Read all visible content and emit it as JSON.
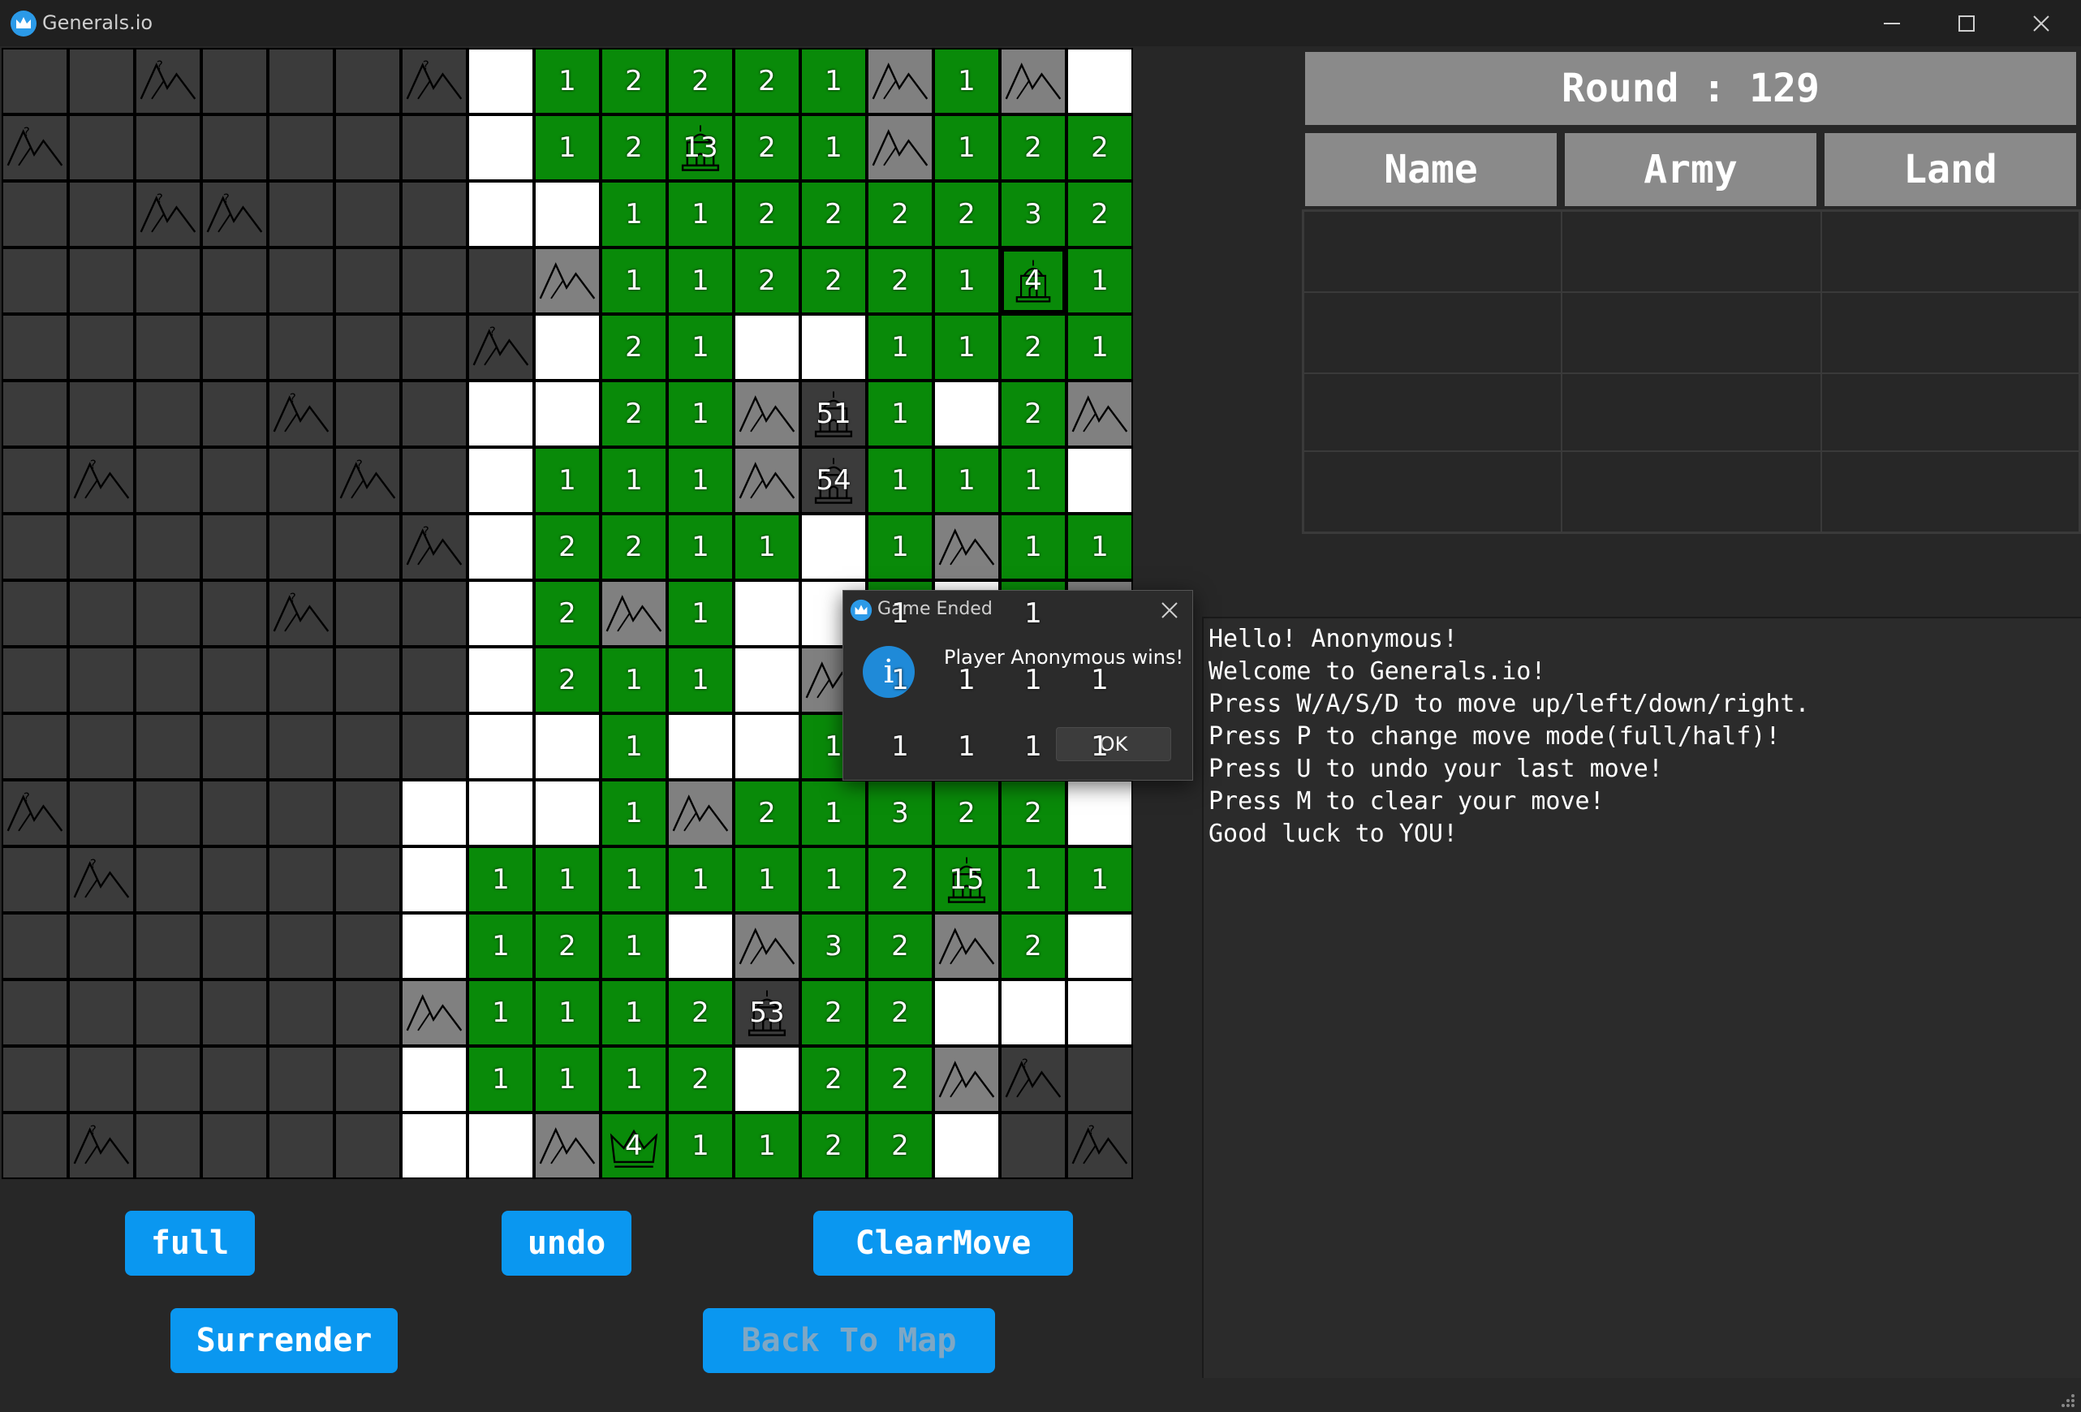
{
  "window": {
    "title": "Generals.io"
  },
  "scoreboard": {
    "round_label": "Round : 129",
    "columns": [
      "Name",
      "Army",
      "Land"
    ]
  },
  "board": {
    "rows": [
      [
        "dark",
        "dark",
        "mtn?",
        "dark",
        "dark",
        "dark",
        "mtn?",
        "white",
        "g:1",
        "g:2",
        "g:2",
        "g:2",
        "g:1",
        "mtn",
        "g:1",
        "mtn",
        "white"
      ],
      [
        "mtn?",
        "dark",
        "dark",
        "dark",
        "dark",
        "dark",
        "dark",
        "white",
        "g:1",
        "g:2",
        "gc:13",
        "g:2",
        "g:1",
        "mtn",
        "g:1",
        "g:2",
        "g:2"
      ],
      [
        "dark",
        "dark",
        "mtn?",
        "mtn?",
        "dark",
        "dark",
        "dark",
        "white",
        "white",
        "g:1",
        "g:1",
        "g:2",
        "g:2",
        "g:2",
        "g:2",
        "g:3",
        "g:2"
      ],
      [
        "dark",
        "dark",
        "dark",
        "dark",
        "dark",
        "dark",
        "dark",
        "dark",
        "mtn",
        "g:1",
        "g:1",
        "g:2",
        "g:2",
        "g:2",
        "g:1",
        "gcb:4",
        "g:1"
      ],
      [
        "dark",
        "dark",
        "dark",
        "dark",
        "dark",
        "dark",
        "dark",
        "mtn?",
        "white",
        "g:2",
        "g:1",
        "white",
        "white",
        "g:1",
        "g:1",
        "g:2",
        "g:1"
      ],
      [
        "dark",
        "dark",
        "dark",
        "dark",
        "mtn?",
        "dark",
        "dark",
        "white",
        "white",
        "g:2",
        "g:1",
        "mtn",
        "tc:51",
        "g:1",
        "white",
        "g:2",
        "mtn"
      ],
      [
        "dark",
        "mtn?",
        "dark",
        "dark",
        "dark",
        "mtn?",
        "dark",
        "white",
        "g:1",
        "g:1",
        "g:1",
        "mtn",
        "tc:54",
        "g:1",
        "g:1",
        "g:1",
        "white"
      ],
      [
        "dark",
        "dark",
        "dark",
        "dark",
        "dark",
        "dark",
        "mtn?",
        "white",
        "g:2",
        "g:2",
        "g:1",
        "g:1",
        "white",
        "g:1",
        "mtn",
        "g:1",
        "g:1"
      ],
      [
        "dark",
        "dark",
        "dark",
        "dark",
        "mtn?",
        "dark",
        "dark",
        "white",
        "g:2",
        "mtn",
        "g:1",
        "white",
        "white",
        "g:1",
        "white",
        "g:1",
        "mtn"
      ],
      [
        "dark",
        "dark",
        "dark",
        "dark",
        "dark",
        "dark",
        "dark",
        "white",
        "g:2",
        "g:1",
        "g:1",
        "white",
        "mtn",
        "g:1",
        "g:1",
        "g:1",
        "g:1"
      ],
      [
        "dark",
        "dark",
        "dark",
        "dark",
        "dark",
        "dark",
        "dark",
        "white",
        "white",
        "g:1",
        "white",
        "white",
        "g:1",
        "g:1",
        "g:1",
        "g:1",
        "g:1"
      ],
      [
        "mtn?",
        "dark",
        "dark",
        "dark",
        "dark",
        "dark",
        "white",
        "white",
        "white",
        "g:1",
        "mtn",
        "g:2",
        "g:1",
        "g:3",
        "g:2",
        "g:2",
        "white"
      ],
      [
        "dark",
        "mtn?",
        "dark",
        "dark",
        "dark",
        "dark",
        "white",
        "g:1",
        "g:1",
        "g:1",
        "g:1",
        "g:1",
        "g:1",
        "g:2",
        "gc:15",
        "g:1",
        "g:1"
      ],
      [
        "dark",
        "dark",
        "dark",
        "dark",
        "dark",
        "dark",
        "white",
        "g:1",
        "g:2",
        "g:1",
        "white",
        "mtn",
        "g:3",
        "g:2",
        "mtn",
        "g:2",
        "white"
      ],
      [
        "dark",
        "dark",
        "dark",
        "dark",
        "dark",
        "dark",
        "mtn",
        "g:1",
        "g:1",
        "g:1",
        "g:2",
        "tc:53",
        "g:2",
        "g:2",
        "white",
        "white",
        "white"
      ],
      [
        "dark",
        "dark",
        "dark",
        "dark",
        "dark",
        "dark",
        "white",
        "g:1",
        "g:1",
        "g:1",
        "g:2",
        "white",
        "g:2",
        "g:2",
        "mtn",
        "mtn?",
        "dark"
      ],
      [
        "dark",
        "mtn?",
        "dark",
        "dark",
        "dark",
        "dark",
        "white",
        "white",
        "mtn",
        "gk:4",
        "g:1",
        "g:1",
        "g:2",
        "g:2",
        "white",
        "dark",
        "mtn?"
      ]
    ]
  },
  "controls": {
    "full_label": "full",
    "undo_label": "undo",
    "clear_label": "ClearMove",
    "surrender_label": "Surrender",
    "back_label": "Back To Map"
  },
  "log": {
    "lines": [
      "Hello! Anonymous!",
      "Welcome to Generals.io!",
      "Press W/A/S/D to move up/left/down/right.",
      "Press P to change move mode(full/half)!",
      "Press U to undo your last move!",
      "Press M to clear your move!",
      "Good luck to YOU!"
    ]
  },
  "dialog": {
    "title": "Game Ended",
    "message": "Player Anonymous wins!",
    "ok_label": "OK",
    "icon": "info-icon"
  },
  "colors": {
    "owned": "#098a09",
    "neutral_city": "#3b3b3b",
    "mountain": "#808080",
    "visible_empty": "#ffffff",
    "fog": "#3b3b3b",
    "button": "#0a97f0"
  }
}
